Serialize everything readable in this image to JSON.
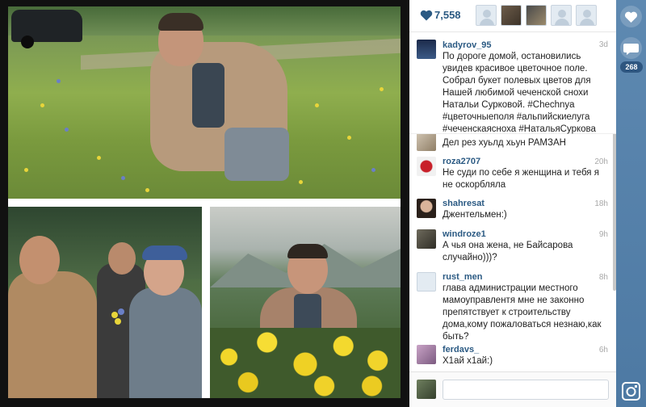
{
  "post": {
    "likes_count": "7,558",
    "comments_count": "268",
    "author": "kadyrov_95",
    "time": "3d",
    "caption": "По дороге домой, остановились увидев красивое цветочное поле. Собрал букет полевых цветов для Нашей любимой чеченской снохи Натальи Сурковой. #Chechnya #цветочныеполя #альпийскиелуга #чеченскаясноха #НатальяСуркова"
  },
  "comments": [
    {
      "user": "",
      "time": "",
      "text": "Дел рез хуьлд хьун РАМЗАН"
    },
    {
      "user": "roza2707",
      "time": "20h",
      "text": "Не суди по себе я женщина и тебя я не оскорбляла"
    },
    {
      "user": "shahresat",
      "time": "18h",
      "text": "Джентельмен:)"
    },
    {
      "user": "windroze1",
      "time": "9h",
      "text": "А чья она жена, не Байсарова случайно)))?"
    },
    {
      "user": "rust_men",
      "time": "8h",
      "text": "глава администрации местного мамоуправлентя мне не законно препятствует к строительству дома,кому пожаловаться незнаю,как быть?"
    },
    {
      "user": "ferdavs_",
      "time": "6h",
      "text": "Х1ай х1ай:)"
    }
  ],
  "comment_input": {
    "value": "",
    "placeholder": ""
  },
  "icons": {
    "like": "heart-icon",
    "comment": "speech-bubble-icon",
    "camera": "instagram-camera-icon"
  },
  "colors": {
    "accent": "#2b5a83",
    "rail": "#5581aa"
  }
}
